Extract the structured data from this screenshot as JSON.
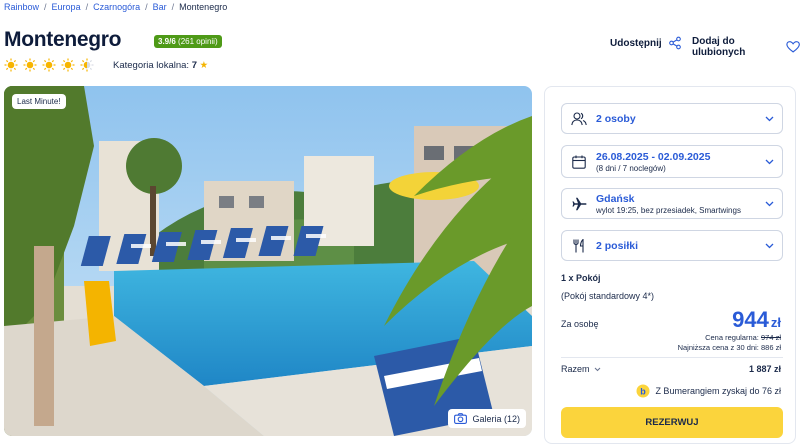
{
  "breadcrumb": [
    {
      "label": "Rainbow",
      "link": true
    },
    {
      "label": "Europa",
      "link": true
    },
    {
      "label": "Czarnogóra",
      "link": true
    },
    {
      "label": "Bar",
      "link": true
    },
    {
      "label": "Montenegro",
      "link": false
    }
  ],
  "hotel": {
    "name": "Montenegro",
    "rating": "3.9/6",
    "rating_count": "(261 opinii)",
    "stars_total": 5,
    "stars_filled": 4.5,
    "local_category_label": "Kategoria lokalna:",
    "local_category_value": "7"
  },
  "actions": {
    "share_label": "Udostępnij",
    "favorite_label": "Dodaj do ulubionych"
  },
  "photo": {
    "badge": "Last Minute!",
    "gallery_label": "Galeria (12)"
  },
  "booking": {
    "persons": "2 osoby",
    "dates": "26.08.2025 - 02.09.2025",
    "dates_sub": "(8 dni / 7 noclegów)",
    "departure": "Gdańsk",
    "departure_sub": "wylot 19:25, bez przesiadek, Smartwings",
    "meals": "2 posiłki",
    "room_count": "1 x Pokój",
    "room_type": "(Pokój standardowy 4*)",
    "per_person_label": "Za osobę",
    "price": "944",
    "currency": "zł",
    "regular_label": "Cena regularna:",
    "regular_price": "974 zł",
    "lowest_label": "Najniższa cena z 30 dni: 886 zł",
    "total_label": "Razem",
    "total_value": "1 887 zł",
    "boomerang": "Z Bumerangiem zyskaj do 76 zł",
    "reserve_button": "REZERWUJ"
  },
  "colors": {
    "accent_blue": "#2a5bd7",
    "rating_green": "#4e9a17",
    "button_yellow": "#fbd43c",
    "sun_yellow": "#f7b500"
  }
}
